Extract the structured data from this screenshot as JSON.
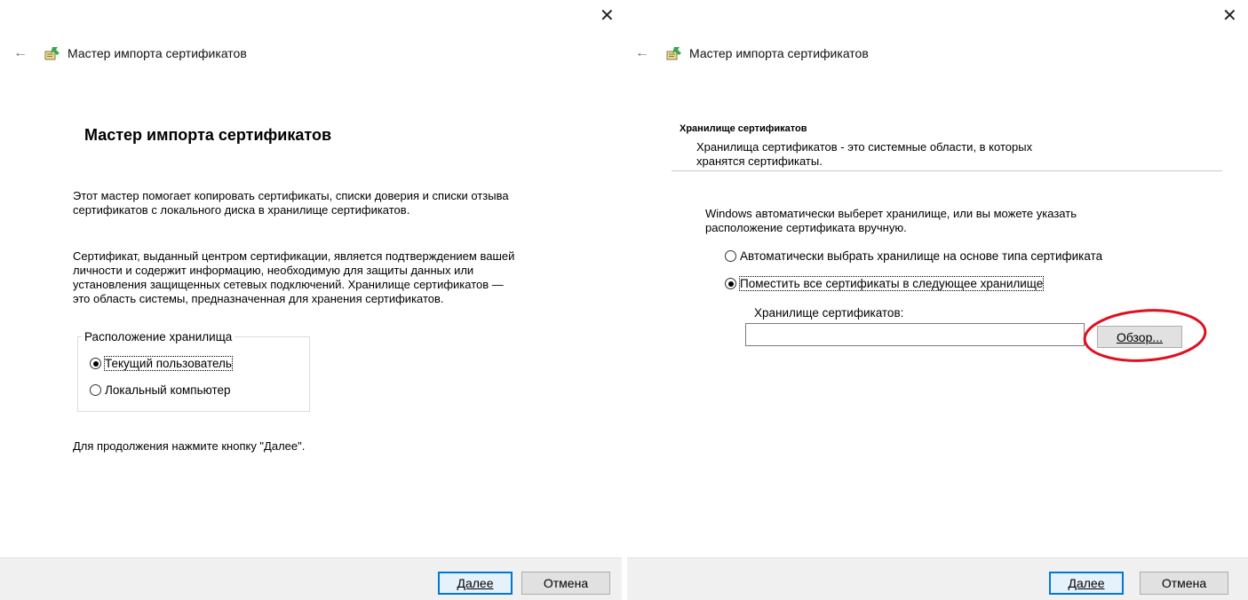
{
  "left": {
    "title": "Мастер импорта сертификатов",
    "heading": "Мастер импорта сертификатов",
    "para1_lines": [
      "Этот мастер помогает копировать сертификаты, списки доверия и списки отзыва",
      "сертификатов с локального диска в хранилище сертификатов."
    ],
    "para2_lines": [
      "Сертификат, выданный центром сертификации, является подтверждением вашей",
      "личности и содержит информацию, необходимую для защиты данных или",
      "установления защищенных сетевых подключений. Хранилище сертификатов —",
      "это область системы, предназначенная для хранения сертификатов."
    ],
    "group_label": "Расположение хранилища",
    "radio_current_user": "Текущий пользователь",
    "radio_local_machine": "Локальный компьютер",
    "continue_text": "Для продолжения нажмите кнопку \"Далее\".",
    "next_label": "Далее",
    "cancel_label": "Отмена"
  },
  "right": {
    "title": "Мастер импорта сертификатов",
    "section_title": "Хранилище сертификатов",
    "section_desc_lines": [
      "Хранилища сертификатов - это системные области, в которых",
      "хранятся сертификаты."
    ],
    "intro_lines": [
      "Windows автоматически выберет хранилище, или вы можете указать",
      "расположение сертификата вручную."
    ],
    "radio_auto": "Автоматически выбрать хранилище на основе типа сертификата",
    "radio_manual": "Поместить все сертификаты в следующее хранилище",
    "store_label": "Хранилище сертификатов:",
    "store_value": "",
    "browse_label": "Обзор...",
    "next_label": "Далее",
    "cancel_label": "Отмена"
  },
  "colors": {
    "accent": "#0078d7",
    "annotation": "#e0101e",
    "footer_bg": "#f0f0f0"
  },
  "icons": {
    "close": "close-icon",
    "back": "back-arrow-icon",
    "wizard": "certificate-wizard-icon"
  }
}
